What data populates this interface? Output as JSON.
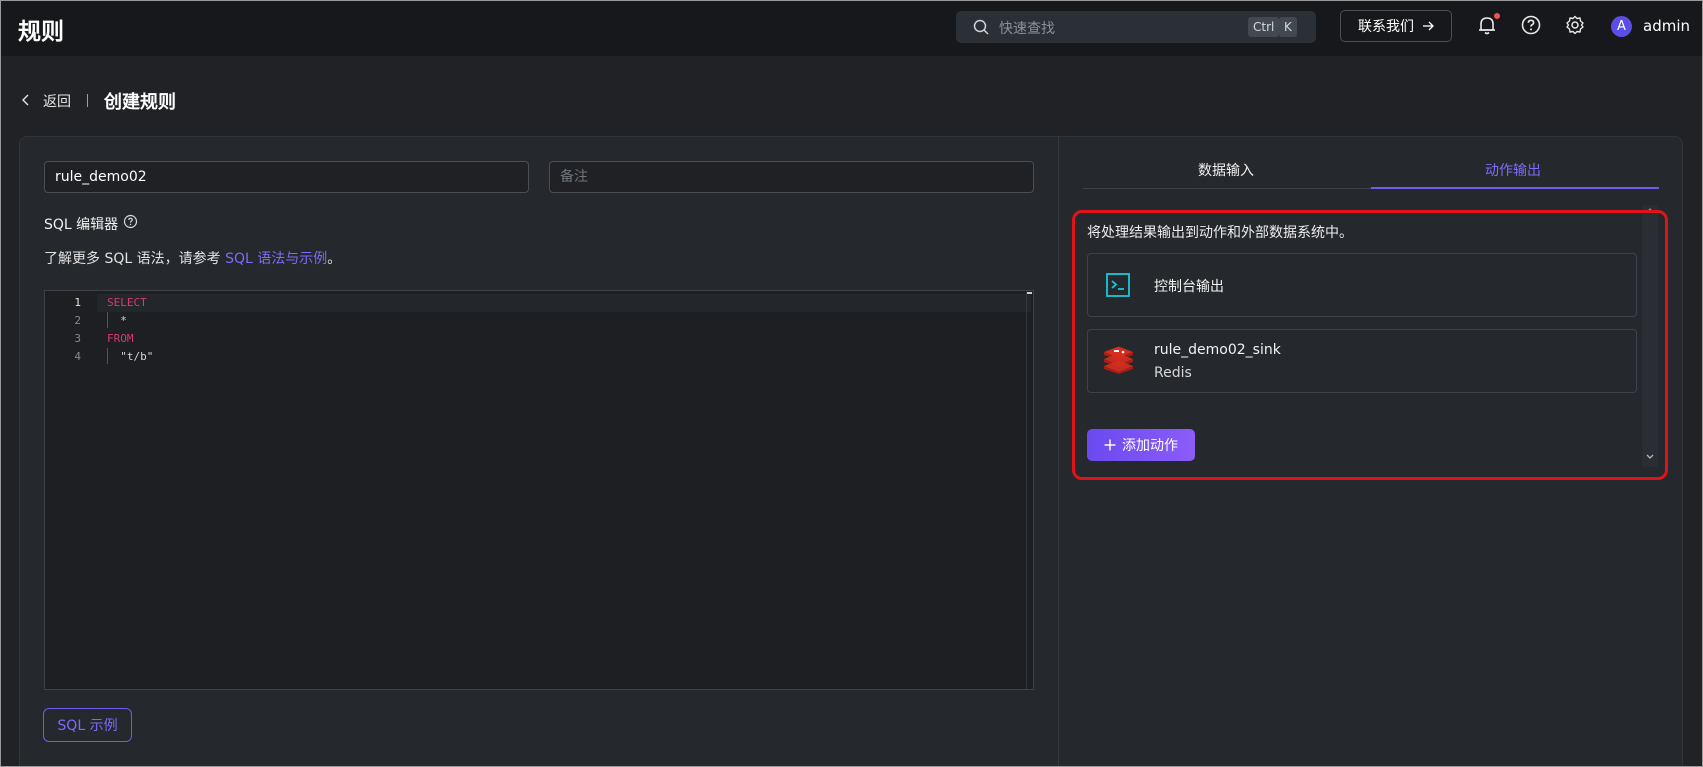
{
  "header": {
    "title": "规则",
    "search_placeholder": "快速查找",
    "shortcut_ctrl": "Ctrl",
    "shortcut_key": "K",
    "contact_label": "联系我们",
    "username": "admin",
    "avatar_letter": "A"
  },
  "breadcrumb": {
    "back_label": "返回",
    "page_title": "创建规则"
  },
  "form": {
    "rule_name": "rule_demo02",
    "note_placeholder": "备注"
  },
  "sql": {
    "label": "SQL 编辑器",
    "desc_prefix": "了解更多 SQL 语法，请参考 ",
    "desc_link": "SQL 语法与示例",
    "desc_suffix": "。",
    "lines": [
      {
        "num": "1",
        "text": "SELECT",
        "kw": true
      },
      {
        "num": "2",
        "text": "  *",
        "kw": false
      },
      {
        "num": "3",
        "text": "FROM",
        "kw": true
      },
      {
        "num": "4",
        "text": "  \"t/b\"",
        "kw": false
      }
    ],
    "example_button": "SQL 示例"
  },
  "panel": {
    "tabs": [
      "数据输入",
      "动作输出"
    ],
    "active_tab": "动作输出",
    "output_desc": "将处理结果输出到动作和外部数据系统中。",
    "actions": [
      {
        "name": "控制台输出",
        "type": "",
        "icon": "console-icon"
      },
      {
        "name": "rule_demo02_sink",
        "type": "Redis",
        "icon": "redis-icon"
      }
    ],
    "add_action_label": "添加动作"
  },
  "colors": {
    "accent": "#6c5cf0",
    "highlight": "#e0121a",
    "keyword": "#d63a6f"
  }
}
